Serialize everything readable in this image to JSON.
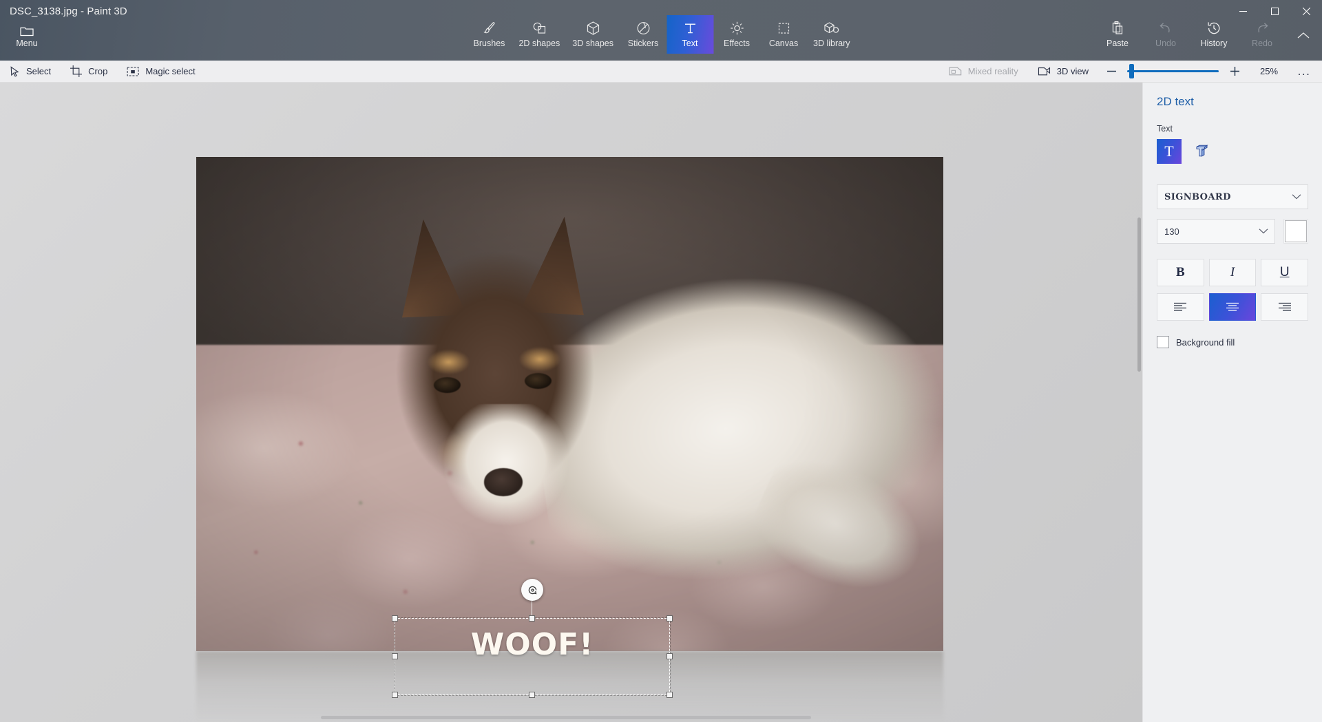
{
  "window": {
    "title": "DSC_3138.jpg - Paint 3D",
    "minimize_label": "Minimize",
    "maximize_label": "Maximize",
    "close_label": "Close"
  },
  "menu": {
    "label": "Menu",
    "icon": "folder-icon"
  },
  "tabs": [
    {
      "label": "Brushes",
      "icon": "brush-icon",
      "active": false
    },
    {
      "label": "2D shapes",
      "icon": "2d-shapes-icon",
      "active": false
    },
    {
      "label": "3D shapes",
      "icon": "3d-shapes-icon",
      "active": false
    },
    {
      "label": "Stickers",
      "icon": "sticker-icon",
      "active": false
    },
    {
      "label": "Text",
      "icon": "text-icon",
      "active": true
    },
    {
      "label": "Effects",
      "icon": "effects-icon",
      "active": false
    },
    {
      "label": "Canvas",
      "icon": "canvas-icon",
      "active": false
    },
    {
      "label": "3D library",
      "icon": "3d-library-icon",
      "active": false
    }
  ],
  "right_tools": [
    {
      "label": "Paste",
      "icon": "clipboard-icon",
      "enabled": true
    },
    {
      "label": "Undo",
      "icon": "undo-icon",
      "enabled": false
    },
    {
      "label": "History",
      "icon": "history-icon",
      "enabled": true
    },
    {
      "label": "Redo",
      "icon": "redo-icon",
      "enabled": false
    }
  ],
  "subbar": {
    "select": {
      "label": "Select",
      "icon": "cursor-icon"
    },
    "crop": {
      "label": "Crop",
      "icon": "crop-icon"
    },
    "magic_select": {
      "label": "Magic select",
      "icon": "magic-select-icon"
    },
    "mixed_reality": {
      "label": "Mixed reality",
      "icon": "mixed-reality-icon",
      "enabled": false
    },
    "view_3d": {
      "label": "3D view",
      "icon": "3d-view-icon",
      "enabled": true
    },
    "zoom_out_label": "Zoom out",
    "zoom_in_label": "Zoom in",
    "zoom_value": "25%",
    "zoom_slider_percent": 8,
    "more_label": "..."
  },
  "canvas": {
    "text_object": {
      "value": "WOOF!",
      "rotate_handle": "rotate-icon"
    }
  },
  "panel": {
    "title": "2D text",
    "text_label": "Text",
    "type_buttons": [
      {
        "name": "2d-text",
        "glyph": "T",
        "selected": true
      },
      {
        "name": "3d-text",
        "glyph": "T",
        "selected": false
      }
    ],
    "font": {
      "value": "SIGNBOARD"
    },
    "size": {
      "value": "130"
    },
    "color": {
      "value": "#ffffff",
      "label": "Text color"
    },
    "bold": {
      "label": "B",
      "selected": false
    },
    "italic": {
      "label": "I",
      "selected": false
    },
    "underline": {
      "label": "U",
      "selected": false
    },
    "align": [
      {
        "name": "align-left",
        "selected": false
      },
      {
        "name": "align-center",
        "selected": true
      },
      {
        "name": "align-right",
        "selected": false
      }
    ],
    "background_fill": {
      "label": "Background fill",
      "checked": false
    }
  },
  "colors": {
    "accent_blue": "#1464c8",
    "accent_purple": "#6a4bdc",
    "panel_title": "#1f5fa8",
    "titlebar": "#5a616a"
  }
}
